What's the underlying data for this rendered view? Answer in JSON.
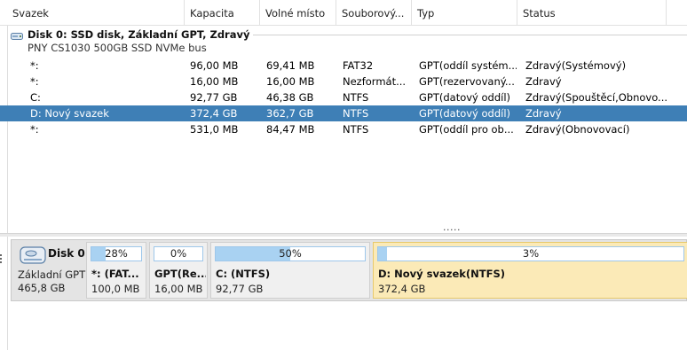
{
  "columns": [
    "Svazek",
    "Kapacita",
    "Volné místo",
    "Souborový...",
    "Typ",
    "Status"
  ],
  "disk_group": {
    "title": "Disk 0: SSD disk, Základní GPT, Zdravý",
    "subtitle": "PNY CS1030 500GB SSD NVMe bus"
  },
  "volumes": [
    {
      "name": "*:",
      "capacity": "96,00 MB",
      "free": "69,41 MB",
      "fs": "FAT32",
      "type": "GPT(oddíl systém...",
      "status": "Zdravý(Systémový)",
      "selected": false
    },
    {
      "name": "*:",
      "capacity": "16,00 MB",
      "free": "16,00 MB",
      "fs": "Nezformát...",
      "type": "GPT(rezervovaný...",
      "status": "Zdravý",
      "selected": false
    },
    {
      "name": "C:",
      "capacity": "92,77 GB",
      "free": "46,38 GB",
      "fs": "NTFS",
      "type": "GPT(datový oddíl)",
      "status": "Zdravý(Spouštěcí,Obnovo...",
      "selected": false
    },
    {
      "name": "D: Nový svazek",
      "capacity": "372,4 GB",
      "free": "362,7 GB",
      "fs": "NTFS",
      "type": "GPT(datový oddíl)",
      "status": "Zdravý",
      "selected": true
    },
    {
      "name": "*:",
      "capacity": "531,0 MB",
      "free": "84,47 MB",
      "fs": "NTFS",
      "type": "GPT(oddíl pro ob...",
      "status": "Zdravý(Obnovovací)",
      "selected": false
    }
  ],
  "more_indicator": ".....",
  "disk_map": {
    "name": "Disk 0",
    "type": "Základní GPT",
    "size": "465,8 GB",
    "icon": "hard-disk-icon",
    "partitions": [
      {
        "label": "*: (FAT...",
        "size": "100,0 MB",
        "pct_text": "28%",
        "used": 0.28,
        "selected": false
      },
      {
        "label": "GPT(Re...",
        "size": "16,00 MB",
        "pct_text": "0%",
        "used": 0.0,
        "selected": false
      },
      {
        "label": "C: (NTFS)",
        "size": "92,77 GB",
        "pct_text": "50%",
        "used": 0.5,
        "selected": false
      },
      {
        "label": "D: Nový svazek(NTFS)",
        "size": "372,4 GB",
        "pct_text": "3%",
        "used": 0.03,
        "selected": true
      }
    ]
  },
  "colors": {
    "selection_row": "#3e7fb6",
    "usage_fill": "#a9d2f2",
    "selected_partition": "#fbeab7"
  }
}
